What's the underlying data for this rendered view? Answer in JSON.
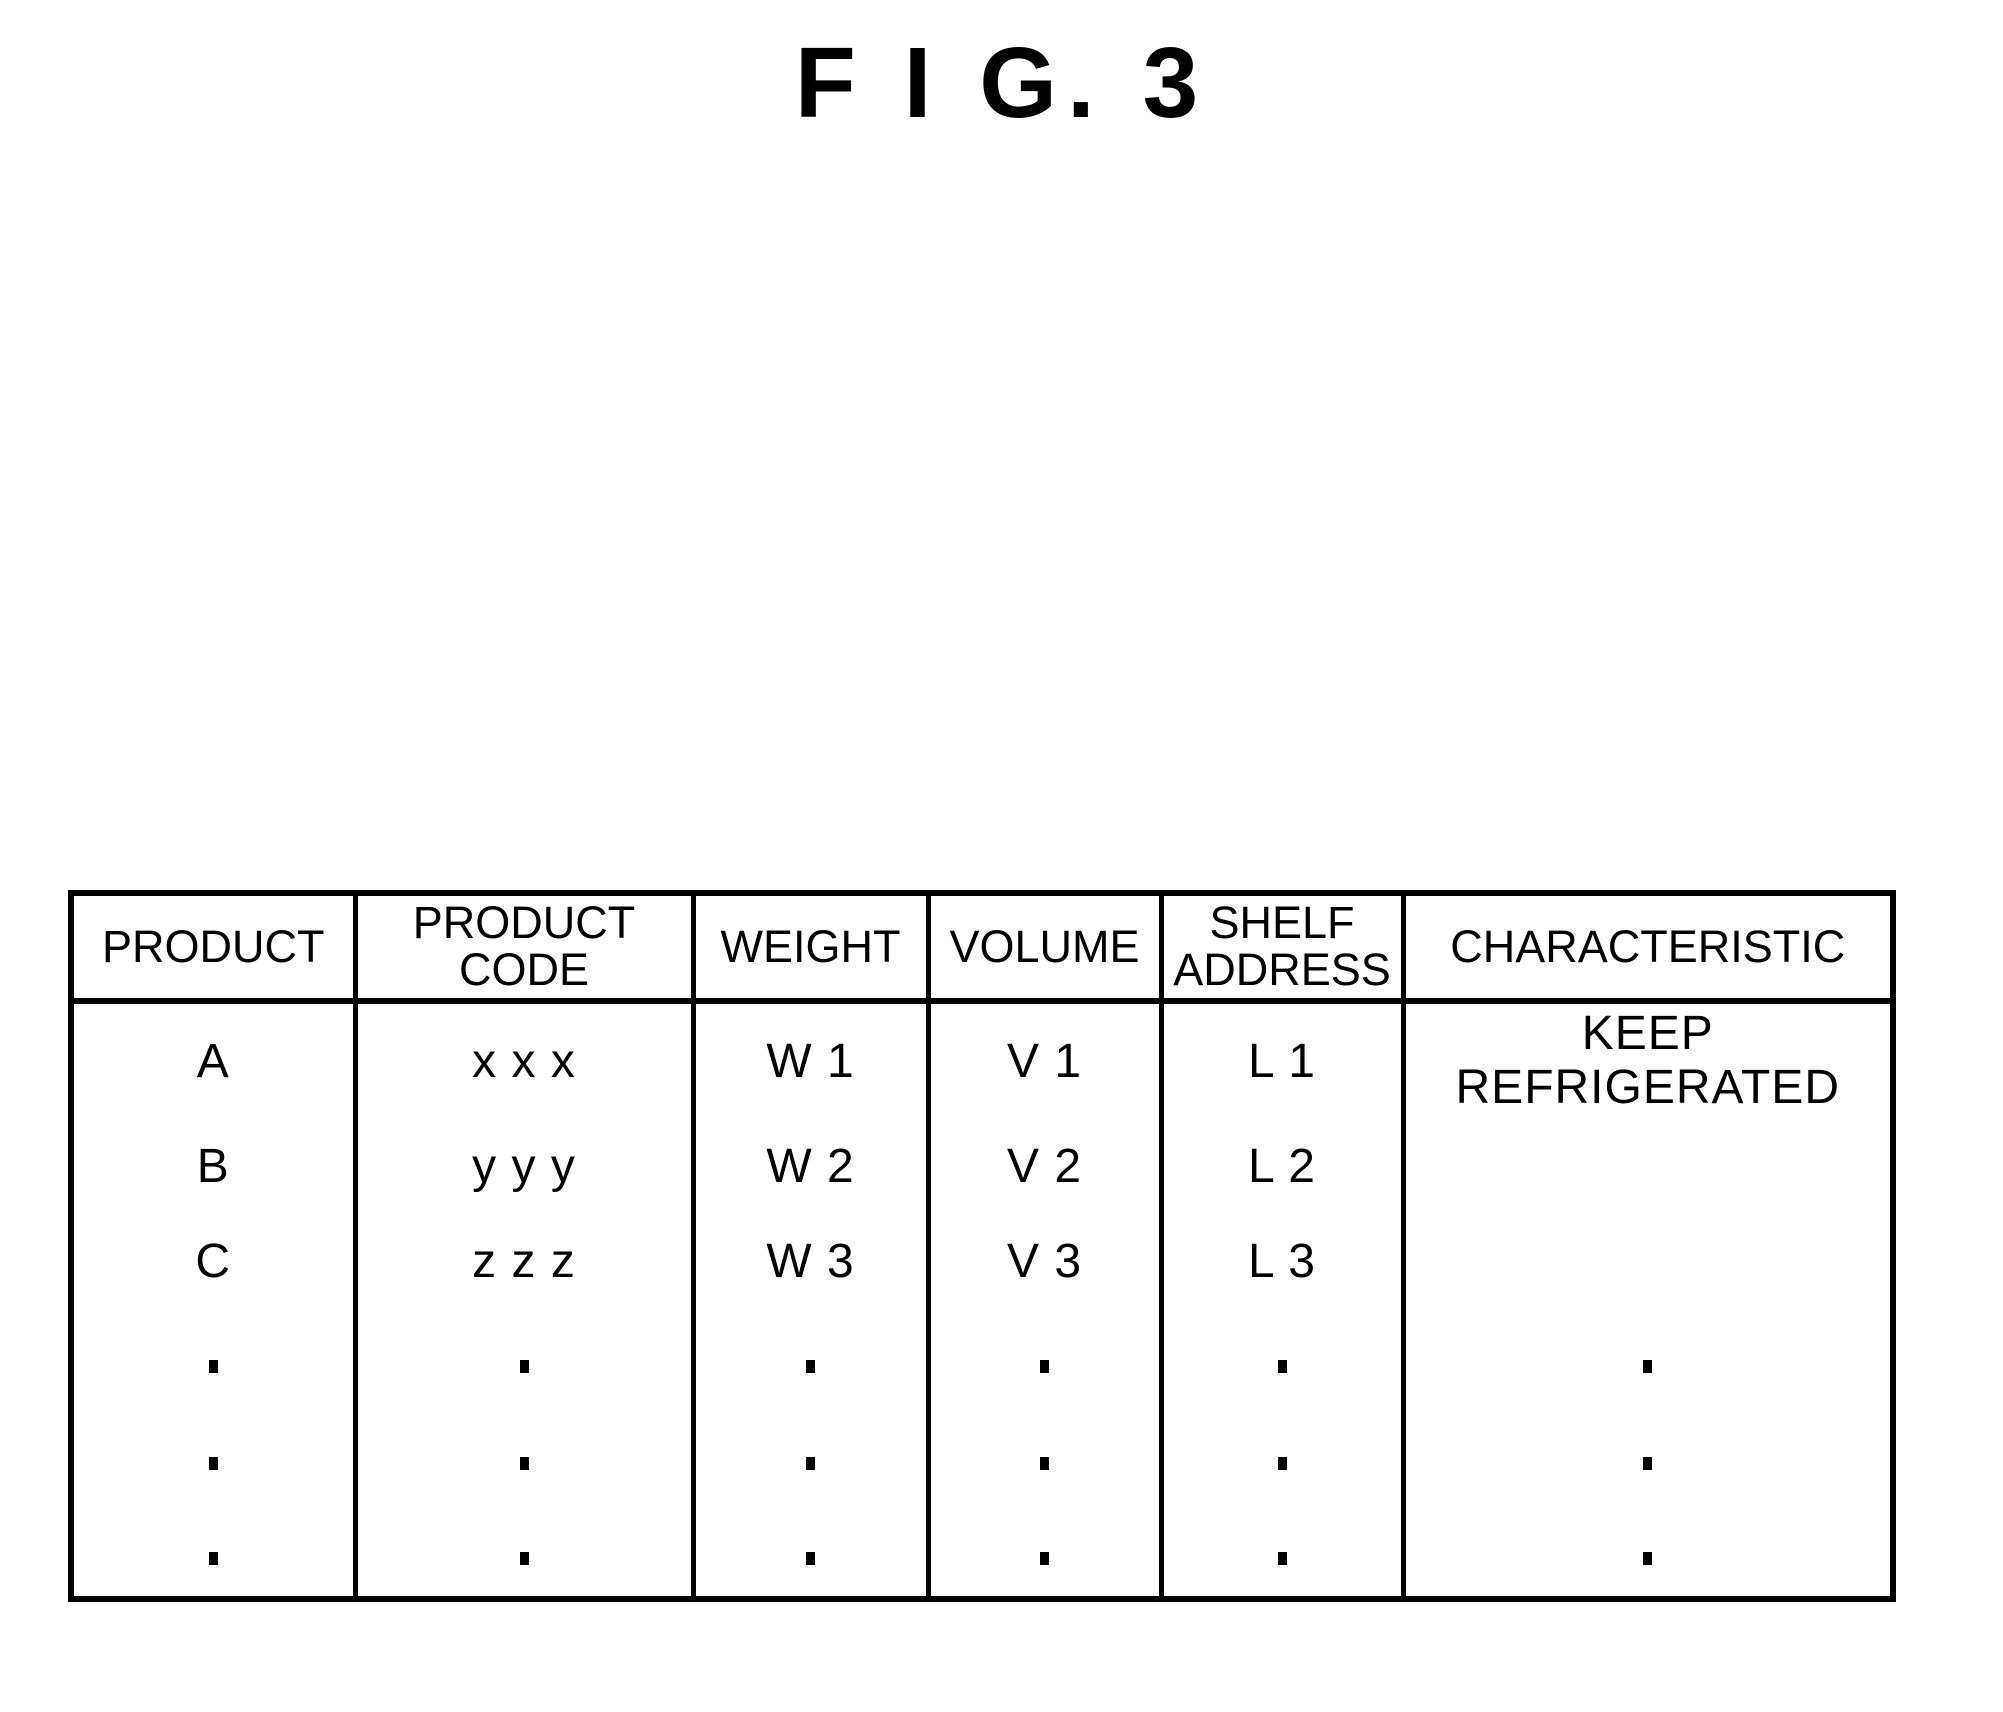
{
  "figure": {
    "title": "F I G. 3"
  },
  "table": {
    "headers": [
      "PRODUCT",
      "PRODUCT\nCODE",
      "WEIGHT",
      "VOLUME",
      "SHELF\nADDRESS",
      "CHARACTERISTIC"
    ],
    "rows": [
      {
        "product": "A",
        "product_code": "x  x  x",
        "weight": "W 1",
        "volume": "V 1",
        "shelf_address": "L 1",
        "characteristic": "KEEP\nREFRIGERATED"
      },
      {
        "product": "B",
        "product_code": "y  y  y",
        "weight": "W 2",
        "volume": "V 2",
        "shelf_address": "L 2",
        "characteristic": ""
      },
      {
        "product": "C",
        "product_code": "z  z  z",
        "weight": "W 3",
        "volume": "V 3",
        "shelf_address": "L 3",
        "characteristic": ""
      }
    ],
    "continuation_rows": 3,
    "continuation_marker": "."
  },
  "colors": {
    "ink": "#000000",
    "background": "#ffffff"
  }
}
